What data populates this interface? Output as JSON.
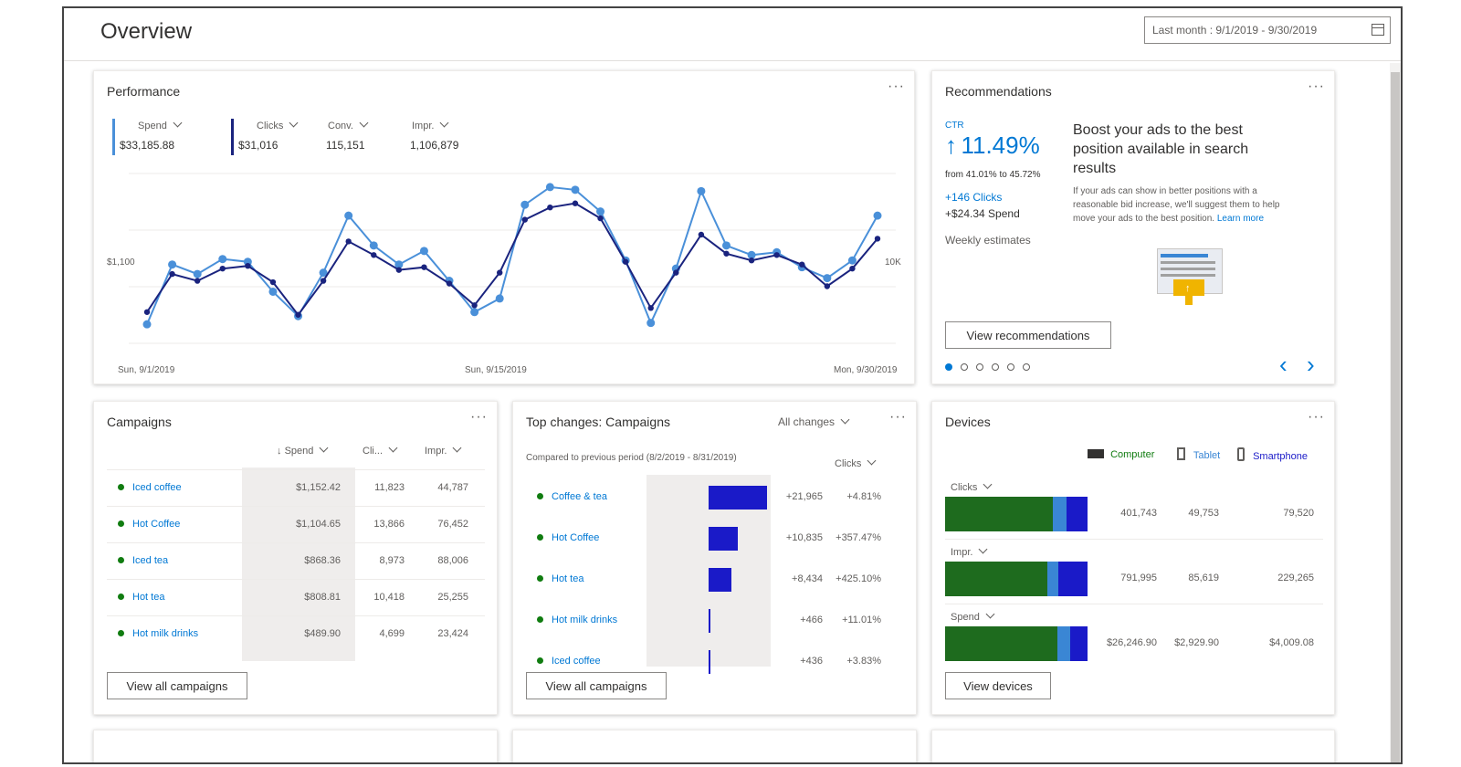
{
  "header": {
    "title": "Overview",
    "date_range": "Last month : 9/1/2019 - 9/30/2019"
  },
  "colors": {
    "spend": "#4a90d9",
    "clicks": "#1a237e",
    "computer": "#1e6b1e",
    "tablet": "#3a86d4",
    "smartphone": "#1a1ac8",
    "accent": "#0078d4",
    "active_dot": "#107c10"
  },
  "performance": {
    "title": "Performance",
    "more": "···",
    "metrics": [
      {
        "label": "Spend",
        "value": "$33,185.88"
      },
      {
        "label": "Clicks",
        "value": "$31,016"
      },
      {
        "label": "Conv.",
        "value": "115,151"
      },
      {
        "label": "Impr.",
        "value": "1,106,879"
      }
    ]
  },
  "chart_data": {
    "type": "line",
    "x_ticks": [
      "Sun, 9/1/2019",
      "Sun, 9/15/2019",
      "Mon, 9/30/2019"
    ],
    "y_left_tick": "$1,100",
    "y_right_tick": "10K",
    "series": [
      {
        "name": "Spend",
        "values": [
          640,
          1080,
          1010,
          1120,
          1100,
          880,
          700,
          1020,
          1440,
          1220,
          1080,
          1180,
          960,
          730,
          830,
          1520,
          1650,
          1630,
          1470,
          1110,
          650,
          1050,
          1620,
          1220,
          1150,
          1170,
          1060,
          980,
          1110,
          1440
        ]
      },
      {
        "name": "Clicks",
        "values": [
          730,
          1010,
          960,
          1050,
          1070,
          950,
          710,
          960,
          1250,
          1150,
          1040,
          1060,
          940,
          780,
          1020,
          1410,
          1500,
          1530,
          1420,
          1100,
          760,
          1020,
          1300,
          1160,
          1110,
          1150,
          1080,
          920,
          1050,
          1270
        ]
      }
    ]
  },
  "recommendations": {
    "title": "Recommendations",
    "more": "···",
    "ctr_label": "CTR",
    "arrow": "↑",
    "ctr_value": "11.49%",
    "ctr_range": "from 41.01% to 45.72%",
    "clicks_gain": "+146 Clicks",
    "spend_gain": "+$24.34 Spend",
    "estimates": "Weekly estimates",
    "headline": "Boost your ads to the best position available in search results",
    "body": "If your ads can show in better positions with a reasonable bid increase, we'll suggest them to help move your ads to the best position.",
    "learn_more": "Learn more",
    "button": "View recommendations",
    "prev": "‹",
    "next": "›",
    "page_count": 6,
    "active_page": 0
  },
  "campaigns": {
    "title": "Campaigns",
    "more": "···",
    "sort_arrow": "↓",
    "columns": [
      "Spend",
      "Cli...",
      "Impr."
    ],
    "rows": [
      {
        "name": "Iced coffee",
        "spend": "$1,152.42",
        "clicks": "11,823",
        "impr": "44,787"
      },
      {
        "name": "Hot Coffee",
        "spend": "$1,104.65",
        "clicks": "13,866",
        "impr": "76,452"
      },
      {
        "name": "Iced tea",
        "spend": "$868.36",
        "clicks": "8,973",
        "impr": "88,006"
      },
      {
        "name": "Hot tea",
        "spend": "$808.81",
        "clicks": "10,418",
        "impr": "25,255"
      },
      {
        "name": "Hot milk drinks",
        "spend": "$489.90",
        "clicks": "4,699",
        "impr": "23,424"
      }
    ],
    "button": "View all campaigns"
  },
  "top_changes": {
    "title": "Top changes: Campaigns",
    "filter": "All changes",
    "more": "···",
    "subtitle": "Compared to previous period (8/2/2019 - 8/31/2019)",
    "metric": "Clicks",
    "rows": [
      {
        "name": "Coffee & tea",
        "change": "+21,965",
        "pct": "+4.81%",
        "value": 21965
      },
      {
        "name": "Hot Coffee",
        "change": "+10,835",
        "pct": "+357.47%",
        "value": 10835
      },
      {
        "name": "Hot tea",
        "change": "+8,434",
        "pct": "+425.10%",
        "value": 8434
      },
      {
        "name": "Hot milk drinks",
        "change": "+466",
        "pct": "+11.01%",
        "value": 466
      },
      {
        "name": "Iced coffee",
        "change": "+436",
        "pct": "+3.83%",
        "value": 436
      }
    ],
    "button": "View all campaigns"
  },
  "devices": {
    "title": "Devices",
    "more": "···",
    "legend": [
      "Computer",
      "Tablet",
      "Smartphone"
    ],
    "groups": [
      {
        "label": "Clicks",
        "values": [
          "401,743",
          "49,753",
          "79,520"
        ],
        "shares": [
          0.757,
          0.093,
          0.15
        ]
      },
      {
        "label": "Impr.",
        "values": [
          "791,995",
          "85,619",
          "229,265"
        ],
        "shares": [
          0.716,
          0.077,
          0.207
        ]
      },
      {
        "label": "Spend",
        "values": [
          "$26,246.90",
          "$2,929.90",
          "$4,009.08"
        ],
        "shares": [
          0.791,
          0.088,
          0.121
        ]
      }
    ],
    "button": "View devices"
  }
}
